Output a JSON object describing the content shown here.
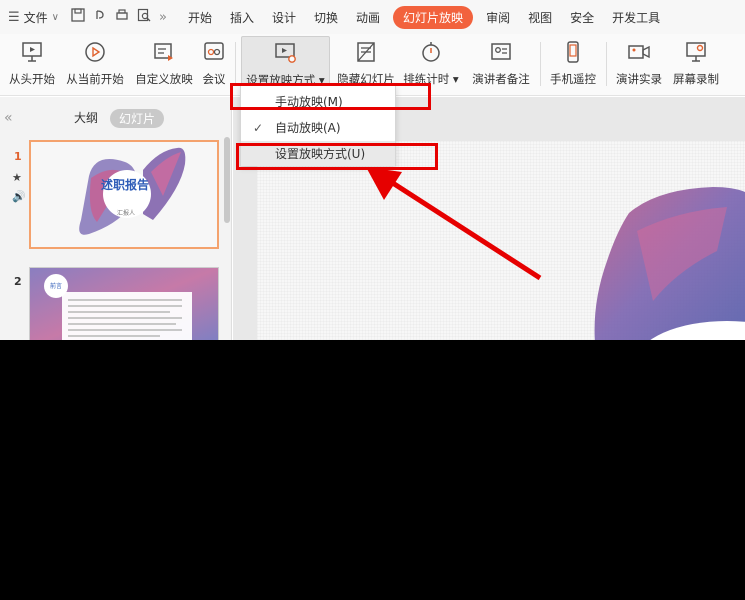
{
  "menu": {
    "file_label": "文件",
    "tabs": [
      {
        "label": "开始"
      },
      {
        "label": "插入"
      },
      {
        "label": "设计"
      },
      {
        "label": "切换"
      },
      {
        "label": "动画"
      },
      {
        "label": "幻灯片放映"
      },
      {
        "label": "审阅"
      },
      {
        "label": "视图"
      },
      {
        "label": "安全"
      },
      {
        "label": "开发工具"
      }
    ],
    "active_tab": "幻灯片放映",
    "accent_color": "#f2623d"
  },
  "ribbon": {
    "buttons": [
      {
        "label": "从头开始",
        "icon": "play-from-start-icon"
      },
      {
        "label": "从当前开始",
        "icon": "play-circle-icon"
      },
      {
        "label": "自定义放映",
        "icon": "custom-show-icon"
      },
      {
        "label": "会议",
        "icon": "meeting-icon"
      },
      {
        "label": "设置放映方式",
        "icon": "slideshow-settings-icon"
      },
      {
        "label": "隐藏幻灯片",
        "icon": "hide-slide-icon"
      },
      {
        "label": "排练计时",
        "icon": "stopwatch-icon"
      },
      {
        "label": "演讲者备注",
        "icon": "speaker-notes-icon"
      },
      {
        "label": "手机遥控",
        "icon": "phone-remote-icon"
      },
      {
        "label": "演讲实录",
        "icon": "video-record-icon"
      },
      {
        "label": "屏幕录制",
        "icon": "screen-record-icon"
      }
    ]
  },
  "dropdown": {
    "items": [
      {
        "label": "手动放映(M)",
        "checked": false
      },
      {
        "label": "自动放映(A)",
        "checked": true
      },
      {
        "label": "设置放映方式(U)",
        "checked": false
      }
    ]
  },
  "left_panel": {
    "tab_outline": "大纲",
    "tab_slides": "幻灯片",
    "slides": [
      {
        "number": "1",
        "title": "述职报告",
        "subtitle": "汇报人"
      },
      {
        "number": "2",
        "title": "前言"
      }
    ]
  },
  "annotation_color": "#e60000"
}
